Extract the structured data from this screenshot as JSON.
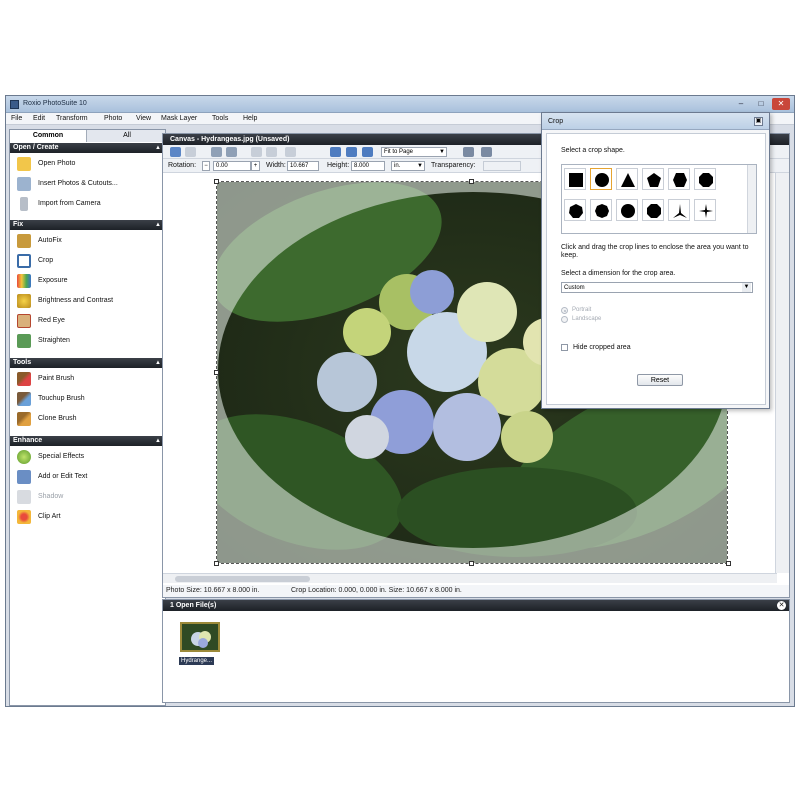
{
  "window": {
    "title": "Roxio PhotoSuite 10",
    "controls": {
      "minimize": "–",
      "maximize": "□",
      "close": "✕"
    }
  },
  "menu": [
    "File",
    "Edit",
    "Transform",
    "Photo",
    "View",
    "Mask Layer",
    "Tools",
    "Help"
  ],
  "left_panel": {
    "tabs": [
      "Common",
      "All"
    ],
    "sections": [
      {
        "title": "Open / Create",
        "items": [
          {
            "label": "Open Photo",
            "icon": "folder-icon"
          },
          {
            "label": "Insert Photos & Cutouts...",
            "icon": "insert-photo-icon"
          },
          {
            "label": "Import from Camera",
            "icon": "camera-icon"
          }
        ]
      },
      {
        "title": "Fix",
        "items": [
          {
            "label": "AutoFix",
            "icon": "autofix-icon"
          },
          {
            "label": "Crop",
            "icon": "crop-icon"
          },
          {
            "label": "Exposure",
            "icon": "exposure-icon"
          },
          {
            "label": "Brightness and Contrast",
            "icon": "brightness-icon"
          },
          {
            "label": "Red Eye",
            "icon": "red-eye-icon"
          },
          {
            "label": "Straighten",
            "icon": "straighten-icon"
          }
        ]
      },
      {
        "title": "Tools",
        "items": [
          {
            "label": "Paint Brush",
            "icon": "paint-brush-icon"
          },
          {
            "label": "Touchup Brush",
            "icon": "touchup-brush-icon"
          },
          {
            "label": "Clone Brush",
            "icon": "clone-brush-icon"
          }
        ]
      },
      {
        "title": "Enhance",
        "items": [
          {
            "label": "Special Effects",
            "icon": "special-effects-icon"
          },
          {
            "label": "Add or Edit Text",
            "icon": "text-icon"
          },
          {
            "label": "Shadow",
            "icon": "shadow-icon"
          },
          {
            "label": "Clip Art",
            "icon": "clip-art-icon"
          }
        ]
      }
    ]
  },
  "canvas": {
    "title": "Canvas - Hydrangeas.jpg (Unsaved)",
    "zoom_select": "Fit to Page",
    "rotation_label": "Rotation:",
    "rotation_value": "0.00",
    "width_label": "Width:",
    "width_value": "10.667",
    "height_label": "Height:",
    "height_value": "8.000",
    "unit": "in.",
    "transparency_label": "Transparency:",
    "status_photo_size": "Photo Size: 10.667 x 8.000 in.",
    "status_crop": "Crop Location: 0.000, 0.000 in. Size: 10.667 x 8.000 in."
  },
  "files_panel": {
    "title": "1 Open File(s)",
    "file_label": "Hydrange..."
  },
  "crop_dialog": {
    "title": "Crop",
    "select_shape": "Select a crop shape.",
    "instructions": "Click and drag the crop lines to enclose the area you want to keep.",
    "select_dimension": "Select a dimension for the crop area.",
    "dimension_value": "Custom",
    "portrait": "Portrait",
    "landscape": "Landscape",
    "hide_cropped": "Hide cropped area",
    "reset": "Reset"
  }
}
